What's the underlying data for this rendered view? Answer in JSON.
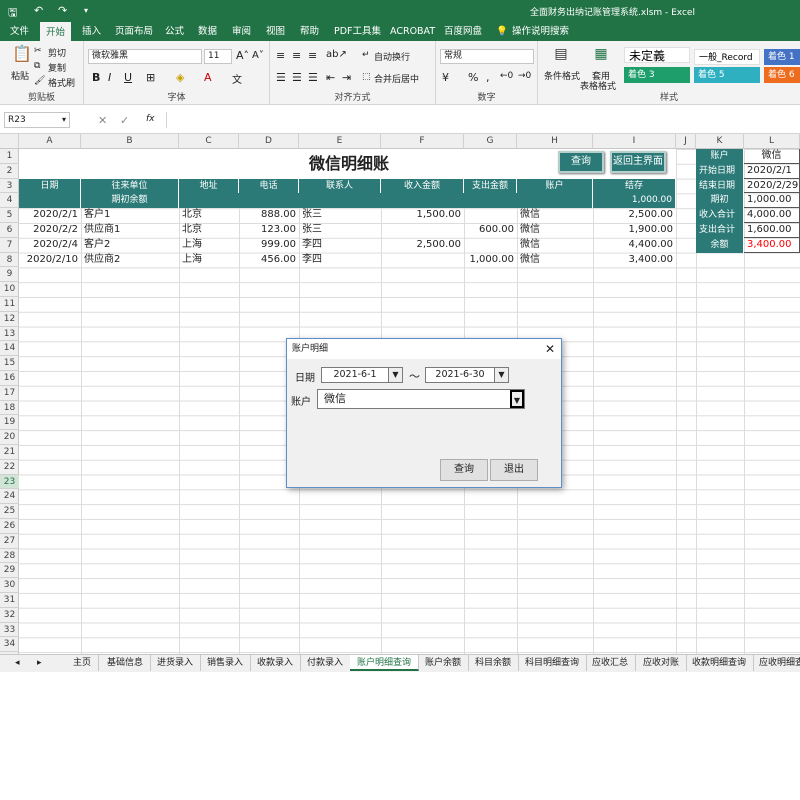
{
  "window": {
    "title": "全面财务出纳记账管理系统.xlsm  -  Excel"
  },
  "ribbon_tabs": [
    "文件",
    "开始",
    "插入",
    "页面布局",
    "公式",
    "数据",
    "审阅",
    "视图",
    "帮助",
    "PDF工具集",
    "ACROBAT",
    "百度网盘",
    "操作说明搜索"
  ],
  "ribbon": {
    "clipboard": {
      "paste": "粘贴",
      "cut": "剪切",
      "copy": "复制",
      "format_painter": "格式刷",
      "label": "剪贴板"
    },
    "font": {
      "name": "微软雅黑",
      "size": "11",
      "label": "字体"
    },
    "alignment": {
      "wrap": "自动换行",
      "merge": "合并后居中",
      "label": "对齐方式"
    },
    "number": {
      "format": "常规",
      "label": "数字"
    },
    "styles": {
      "conditional": "条件格式",
      "table_format_1": "套用",
      "table_format_2": "表格格式",
      "label": "样式",
      "cells": [
        {
          "text": "未定義",
          "bg": "#ffffff",
          "fg": "#000000"
        },
        {
          "text": "一般_Record",
          "bg": "#ffffff",
          "fg": "#000000"
        },
        {
          "text": "着色 1",
          "bg": "#4472c4",
          "fg": "#ffffff"
        },
        {
          "text": "着色 3",
          "bg": "#1e9e6a",
          "fg": "#ffffff"
        },
        {
          "text": "着色 5",
          "bg": "#2fb0c0",
          "fg": "#ffffff"
        },
        {
          "text": "着色 6",
          "bg": "#ed6c1e",
          "fg": "#ffffff"
        }
      ]
    }
  },
  "formula_bar": {
    "name_box": "R23",
    "fx": "fx",
    "value": ""
  },
  "columns": [
    "A",
    "B",
    "C",
    "D",
    "E",
    "F",
    "G",
    "H",
    "I",
    "J",
    "K",
    "L"
  ],
  "sheet": {
    "title": "微信明细账",
    "query_button": "查询",
    "home_button": "返回主界面",
    "headers": [
      "日期",
      "往来单位",
      "地址",
      "电话",
      "联系人",
      "收入金额",
      "支出金额",
      "账户",
      "结存"
    ],
    "opening_label": "期初余额",
    "opening_balance": "1,000.00",
    "rows": [
      [
        "2020/2/1",
        "客户1",
        "北京",
        "888.00",
        "张三",
        "1,500.00",
        "",
        "微信",
        "2,500.00"
      ],
      [
        "2020/2/2",
        "供应商1",
        "北京",
        "123.00",
        "张三",
        "",
        "600.00",
        "微信",
        "1,900.00"
      ],
      [
        "2020/2/4",
        "客户2",
        "上海",
        "999.00",
        "李四",
        "2,500.00",
        "",
        "微信",
        "4,400.00"
      ],
      [
        "2020/2/10",
        "供应商2",
        "上海",
        "456.00",
        "李四",
        "",
        "1,000.00",
        "微信",
        "3,400.00"
      ]
    ],
    "summary": [
      {
        "label": "账户",
        "value": "微信"
      },
      {
        "label": "开始日期",
        "value": "2020/2/1"
      },
      {
        "label": "结束日期",
        "value": "2020/2/29"
      },
      {
        "label": "期初",
        "value": "1,000.00"
      },
      {
        "label": "收入合计",
        "value": "4,000.00"
      },
      {
        "label": "支出合计",
        "value": "1,600.00"
      },
      {
        "label": "余额",
        "value": "3,400.00"
      }
    ],
    "balance_color": "#ff0000"
  },
  "row_numbers": [
    "1",
    "2",
    "3",
    "4",
    "5",
    "6",
    "7",
    "8",
    "9",
    "10",
    "11",
    "12",
    "13",
    "14",
    "15",
    "16",
    "17",
    "18",
    "19",
    "20",
    "21",
    "22",
    "23",
    "24",
    "25",
    "26",
    "27",
    "28",
    "29",
    "30",
    "31",
    "32",
    "33",
    "34"
  ],
  "sheet_tabs": [
    "主页",
    "基础信息",
    "进货录入",
    "销售录入",
    "收款录入",
    "付款录入",
    "账户明细查询",
    "账户余额",
    "科目余额",
    "科目明细查询",
    "应收汇总",
    "应收对账",
    "收款明细查询",
    "应收明细查"
  ],
  "active_sheet_tab": "账户明细查询",
  "dialog": {
    "title": "账户明细",
    "date_label": "日期",
    "date_from": "2021-6-1",
    "tilde": "～",
    "date_to": "2021-6-30",
    "account_label": "账户",
    "account_value": "微信",
    "query": "查询",
    "exit": "退出"
  },
  "colors": {
    "excel_green": "#217346",
    "header_teal": "#2b7a78"
  }
}
